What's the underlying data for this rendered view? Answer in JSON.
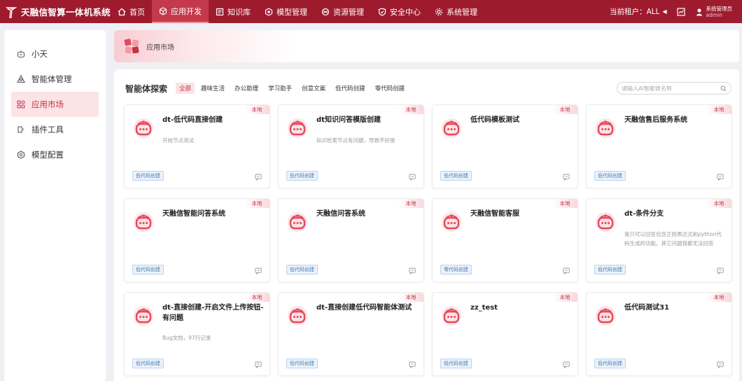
{
  "app": {
    "title": "天融信智算一体机系统"
  },
  "nav": [
    {
      "label": "首页",
      "icon": "home-icon",
      "active": false
    },
    {
      "label": "应用开发",
      "icon": "cube-icon",
      "active": true
    },
    {
      "label": "知识库",
      "icon": "book-icon",
      "active": false
    },
    {
      "label": "模型管理",
      "icon": "model-icon",
      "active": false
    },
    {
      "label": "资源管理",
      "icon": "resource-icon",
      "active": false
    },
    {
      "label": "安全中心",
      "icon": "shield-icon",
      "active": false
    },
    {
      "label": "系统管理",
      "icon": "gear-icon",
      "active": false
    }
  ],
  "header": {
    "tenant_label": "当前租户：ALL",
    "user_role": "系统管理员",
    "user_name": "admin"
  },
  "sidebar": {
    "items": [
      {
        "label": "小天",
        "icon": "robot-icon",
        "active": false
      },
      {
        "label": "智能体管理",
        "icon": "agent-icon",
        "active": false
      },
      {
        "label": "应用市场",
        "icon": "grid-icon",
        "active": true
      },
      {
        "label": "插件工具",
        "icon": "plugin-icon",
        "active": false
      },
      {
        "label": "模型配置",
        "icon": "settings-icon",
        "active": false
      }
    ]
  },
  "banner": {
    "title": "应用市场"
  },
  "panel": {
    "title": "智能体探索",
    "filters": [
      "全部",
      "趣味生活",
      "办公助理",
      "学习助手",
      "创意文案",
      "低代码创建",
      "零代码创建"
    ],
    "active_filter": 0,
    "search_placeholder": "请输入AI智能体名称"
  },
  "cards": [
    {
      "title": "dt-低代码直接创建",
      "desc": "开始节点测试",
      "badge": "本地",
      "tag": "低代码创建"
    },
    {
      "title": "dt知识问答模版创建",
      "desc": "知识检索节点有问题，导致不好使",
      "badge": "本地",
      "tag": "低代码创建"
    },
    {
      "title": "低代码模板测试",
      "desc": "",
      "badge": "本地",
      "tag": "低代码创建"
    },
    {
      "title": "天融信售后服务系统",
      "desc": "",
      "badge": "本地",
      "tag": "低代码创建"
    },
    {
      "title": "天融信智能问答系统",
      "desc": "",
      "badge": "本地",
      "tag": "低代码创建"
    },
    {
      "title": "天融信问答系统",
      "desc": "",
      "badge": "本地",
      "tag": "低代码创建"
    },
    {
      "title": "天融信智能客服",
      "desc": "",
      "badge": "本地",
      "tag": "零代码创建"
    },
    {
      "title": "dt-条件分支",
      "desc": "我只可以回答包含正则表达式和python代码生成的功能，其它问题我都无法回答",
      "badge": "本地",
      "tag": "低代码创建"
    },
    {
      "title": "dt-直接创建-开启文件上传按钮-有问题",
      "desc": "Bug文档，97行记录",
      "badge": "本地",
      "tag": "低代码创建"
    },
    {
      "title": "dt-直接创建低代码智能体测试",
      "desc": "",
      "badge": "本地",
      "tag": "低代码创建"
    },
    {
      "title": "zz_test",
      "desc": "",
      "badge": "本地",
      "tag": "低代码创建"
    },
    {
      "title": "低代码测试31",
      "desc": "",
      "badge": "本地",
      "tag": "低代码创建"
    }
  ],
  "colors": {
    "brand": "#9e1b2e",
    "accent": "#e8475b",
    "active_bg": "#fbe3e6"
  }
}
